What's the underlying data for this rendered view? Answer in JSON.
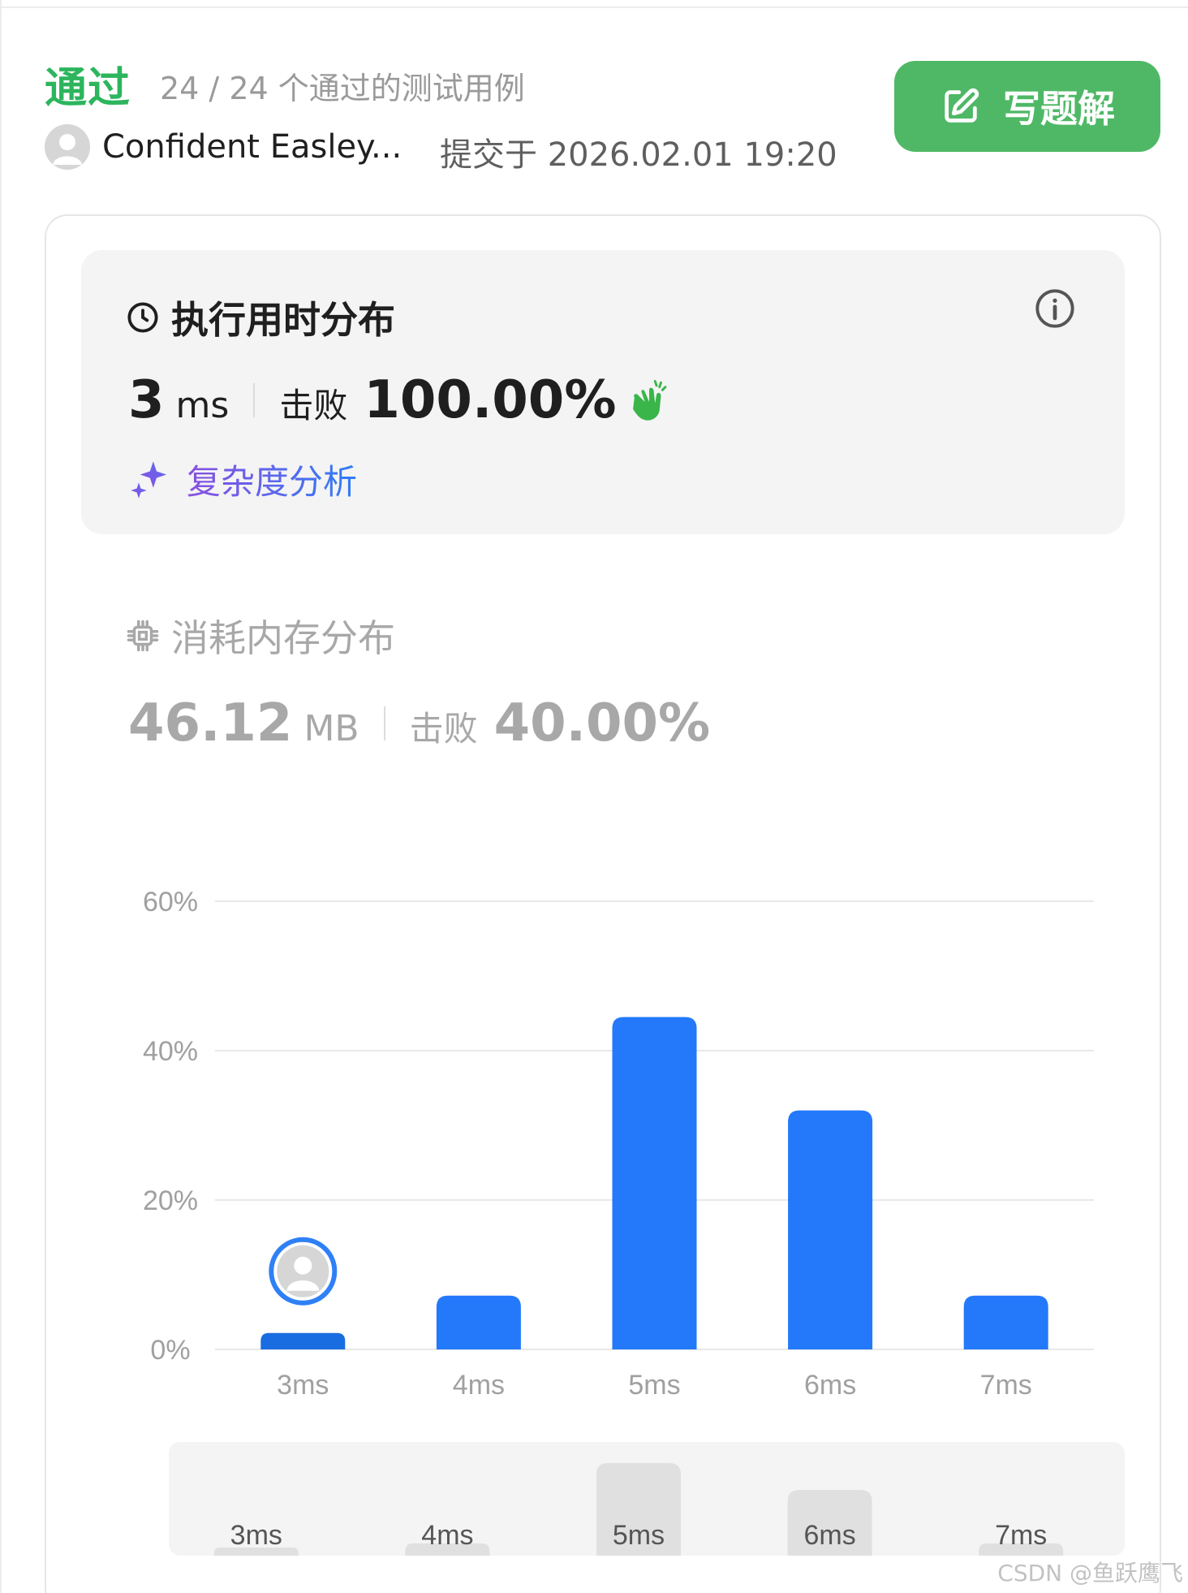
{
  "header": {
    "status": "通过",
    "testcases": "24 / 24 个通过的测试用例",
    "username": "Confident Easley...",
    "submitted": "提交于 2026.02.01 19:20",
    "solution_button": "写题解"
  },
  "runtime": {
    "title": "执行用时分布",
    "value": "3",
    "unit": "ms",
    "beat_label": "击败",
    "beat_value": "100.00%",
    "complexity_link": "复杂度分析"
  },
  "memory": {
    "title": "消耗内存分布",
    "value": "46.12",
    "unit": "MB",
    "beat_label": "击败",
    "beat_value": "40.00%"
  },
  "chart_data": {
    "type": "bar",
    "categories": [
      "3ms",
      "4ms",
      "5ms",
      "6ms",
      "7ms"
    ],
    "values": [
      2.2,
      7.2,
      44.5,
      32,
      7.2
    ],
    "ylim": [
      0,
      60
    ],
    "yticks": [
      "0%",
      "20%",
      "40%",
      "60%"
    ],
    "ytick_values": [
      0,
      20,
      40,
      60
    ],
    "highlight_category": "3ms",
    "grid": true,
    "colors": {
      "bar": "#2379fa",
      "bar_highlight": "#1a6de0",
      "grid": "#e8e8e8",
      "tick": "#a0a0a0"
    }
  },
  "overview": {
    "categories": [
      "3ms",
      "4ms",
      "5ms",
      "6ms",
      "7ms"
    ],
    "values": [
      2.2,
      7.2,
      44.5,
      32,
      7.2
    ],
    "highlight_category": "5ms"
  },
  "watermark": "CSDN @鱼跃鹰飞",
  "colors": {
    "accent_green": "#2db55d",
    "button_green": "#4fb866",
    "link_purple": "#8a4fe0",
    "link_blue": "#2f7df6",
    "clap_green": "#3ab54a"
  }
}
